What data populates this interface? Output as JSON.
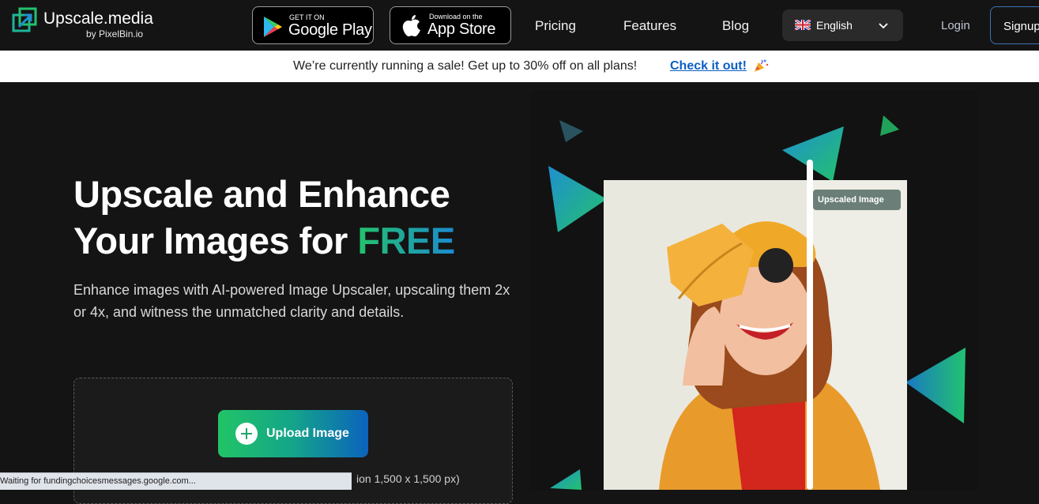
{
  "brand": {
    "name": "Upscale.media",
    "sub": "by PixelBin.io"
  },
  "stores": {
    "google": {
      "small": "GET IT ON",
      "big": "Google Play"
    },
    "apple": {
      "small": "Download on the",
      "big": "App Store"
    }
  },
  "nav": {
    "pricing": "Pricing",
    "features": "Features",
    "blog": "Blog"
  },
  "language": {
    "selected": "English"
  },
  "auth": {
    "login": "Login",
    "signup": "Signup"
  },
  "banner": {
    "message": "We’re currently running a sale! Get up to 30% off on all plans!",
    "cta": "Check it out!"
  },
  "hero": {
    "title_line1": "Upscale and Enhance",
    "title_line2_prefix": "Your Images for ",
    "title_highlight": "FREE",
    "description": "Enhance images with AI-powered Image Upscaler, upscaling them 2x or 4x, and witness the unmatched clarity and details."
  },
  "upload": {
    "button": "Upload Image",
    "note_visible": "ion 1,500 x 1,500 px)"
  },
  "showcase": {
    "tag": "Upscaled Image"
  },
  "status_bar": {
    "text": "Waiting for fundingchoicesmessages.google.com..."
  },
  "colors": {
    "accent_green": "#23c26b",
    "accent_blue": "#0b63bd",
    "link": "#0b5fc4"
  }
}
